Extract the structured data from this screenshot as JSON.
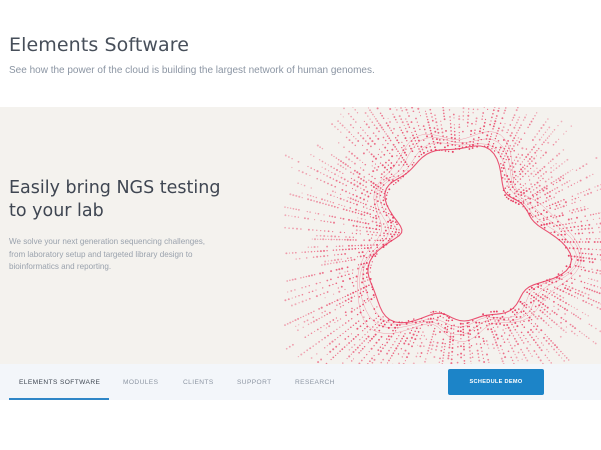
{
  "intro": {
    "title": "Elements Software",
    "subtitle": "See how the power of the cloud is building the largest network of human genomes."
  },
  "hero": {
    "heading_lines": [
      "Easily bring NGS testing",
      "to your lab"
    ],
    "body_lines": [
      "We solve your next generation sequencing challenges,",
      "from laboratory setup and targeted library design to",
      "bioinformatics and reporting."
    ],
    "art_color": "#e8365c",
    "background": "#f4f2ee"
  },
  "subnav": {
    "items": [
      {
        "label": "ELEMENTS SOFTWARE",
        "active": true
      },
      {
        "label": "MODULES",
        "active": false
      },
      {
        "label": "CLIENTS",
        "active": false
      },
      {
        "label": "SUPPORT",
        "active": false
      },
      {
        "label": "RESEARCH",
        "active": false
      }
    ],
    "cta_label": "SCHEDULE DEMO",
    "accent": "#1c84c8"
  }
}
